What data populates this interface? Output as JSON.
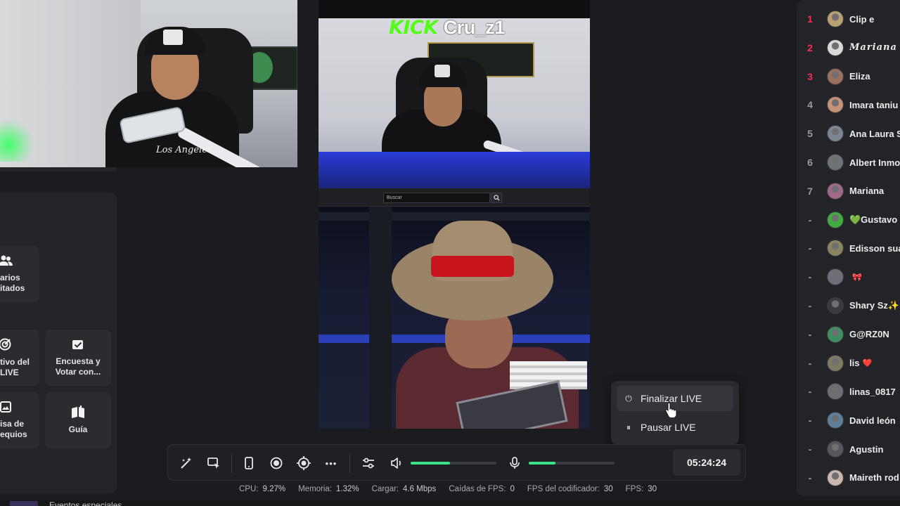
{
  "stream": {
    "platform_logo_text": "KICK",
    "username": "Cru_z1",
    "webcam_shirt_text": "Los Angeles"
  },
  "browser": {
    "search_placeholder": "Buscar",
    "search_icon": "search-icon"
  },
  "left_panel": {
    "tools": [
      {
        "label_line1": "arios",
        "label_line2": "itados",
        "icon": "users-icon"
      },
      {
        "label_line1": "tivo del",
        "label_line2": "LIVE",
        "icon": "target-icon"
      },
      {
        "label_line1": "Encuesta y",
        "label_line2": "Votar con...",
        "icon": "poll-check-icon"
      },
      {
        "label_line1": "isa de",
        "label_line2": "equios",
        "icon": "image-icon"
      },
      {
        "label_line1": "Guía",
        "label_line2": "",
        "icon": "guide-book-icon"
      }
    ]
  },
  "live_menu": {
    "items": [
      {
        "label": "Finalizar LIVE",
        "icon": "power-icon",
        "glyph": "⏻",
        "active": true
      },
      {
        "label": "Pausar LIVE",
        "icon": "pause-icon",
        "glyph": "⏸",
        "active": false
      }
    ]
  },
  "toolbar": {
    "buttons": [
      {
        "icon": "magic-wand-icon",
        "glyph": "✦"
      },
      {
        "icon": "screen-share-icon",
        "glyph": "⧉"
      },
      {
        "icon": "phone-icon",
        "glyph": "▯"
      },
      {
        "icon": "record-icon",
        "glyph": "◉"
      },
      {
        "icon": "camera-focus-icon",
        "glyph": "◎"
      },
      {
        "icon": "more-icon",
        "glyph": "•••"
      },
      {
        "icon": "settings-sliders-icon",
        "glyph": "⚟"
      },
      {
        "icon": "speaker-icon",
        "glyph": "🔈"
      },
      {
        "icon": "microphone-icon",
        "glyph": "🎙"
      }
    ],
    "speaker_volume": 0.46,
    "mic_volume": 0.31,
    "slider_color": "#3ee28a",
    "timer": "05:24:24"
  },
  "stats": [
    {
      "label": "CPU:",
      "value": "9.27%"
    },
    {
      "label": "Memoria:",
      "value": "1.32%"
    },
    {
      "label": "Cargar:",
      "value": "4.6 Mbps"
    },
    {
      "label": "Caídas de FPS:",
      "value": "0"
    },
    {
      "label": "FPS del codificador:",
      "value": "30"
    },
    {
      "label": "FPS:",
      "value": "30"
    }
  ],
  "bottom_text": "Eventos especiales",
  "ranking": {
    "accent_color": "#ff2b52",
    "rows": [
      {
        "rank": "1",
        "name": "Clip e",
        "badge": "",
        "avatar": "#b8a070"
      },
      {
        "rank": "2",
        "name": "Mariana",
        "badge": "",
        "avatar": "#d9d9dc"
      },
      {
        "rank": "3",
        "name": "Eliza",
        "badge": "",
        "avatar": "#9a6f5d"
      },
      {
        "rank": "4",
        "name": "Imara taniu",
        "badge": "",
        "avatar": "#c49274"
      },
      {
        "rank": "5",
        "name": "Ana Laura S",
        "badge": "",
        "avatar": "#7c8592"
      },
      {
        "rank": "6",
        "name": "Albert Inmo",
        "badge": "",
        "avatar": "#6e7378"
      },
      {
        "rank": "7",
        "name": "Mariana",
        "badge": "",
        "avatar": "#a06a8a"
      },
      {
        "rank": "-",
        "name": "💚Gustavo",
        "badge": "",
        "avatar": "#3fae3f"
      },
      {
        "rank": "-",
        "name": "Edisson sua",
        "badge": "",
        "avatar": "#8a8460"
      },
      {
        "rank": "-",
        "name": "",
        "badge": "🎀",
        "avatar": "#6d7077"
      },
      {
        "rank": "-",
        "name": "Shary Sz✨",
        "badge": "",
        "avatar": "#3a3a40"
      },
      {
        "rank": "-",
        "name": "G@RZ0N",
        "badge": "",
        "avatar": "#3e8f5e"
      },
      {
        "rank": "-",
        "name": "lis",
        "badge": "❤️",
        "avatar": "#7d7a62"
      },
      {
        "rank": "-",
        "name": "linas_0817",
        "badge": "",
        "avatar": "#6b6e72"
      },
      {
        "rank": "-",
        "name": "David león",
        "badge": "",
        "avatar": "#5d7f9a"
      },
      {
        "rank": "-",
        "name": "Agustin",
        "badge": "",
        "avatar": "#55575c"
      },
      {
        "rank": "-",
        "name": "Maireth rod",
        "badge": "",
        "avatar": "#c9b7b0"
      }
    ]
  }
}
